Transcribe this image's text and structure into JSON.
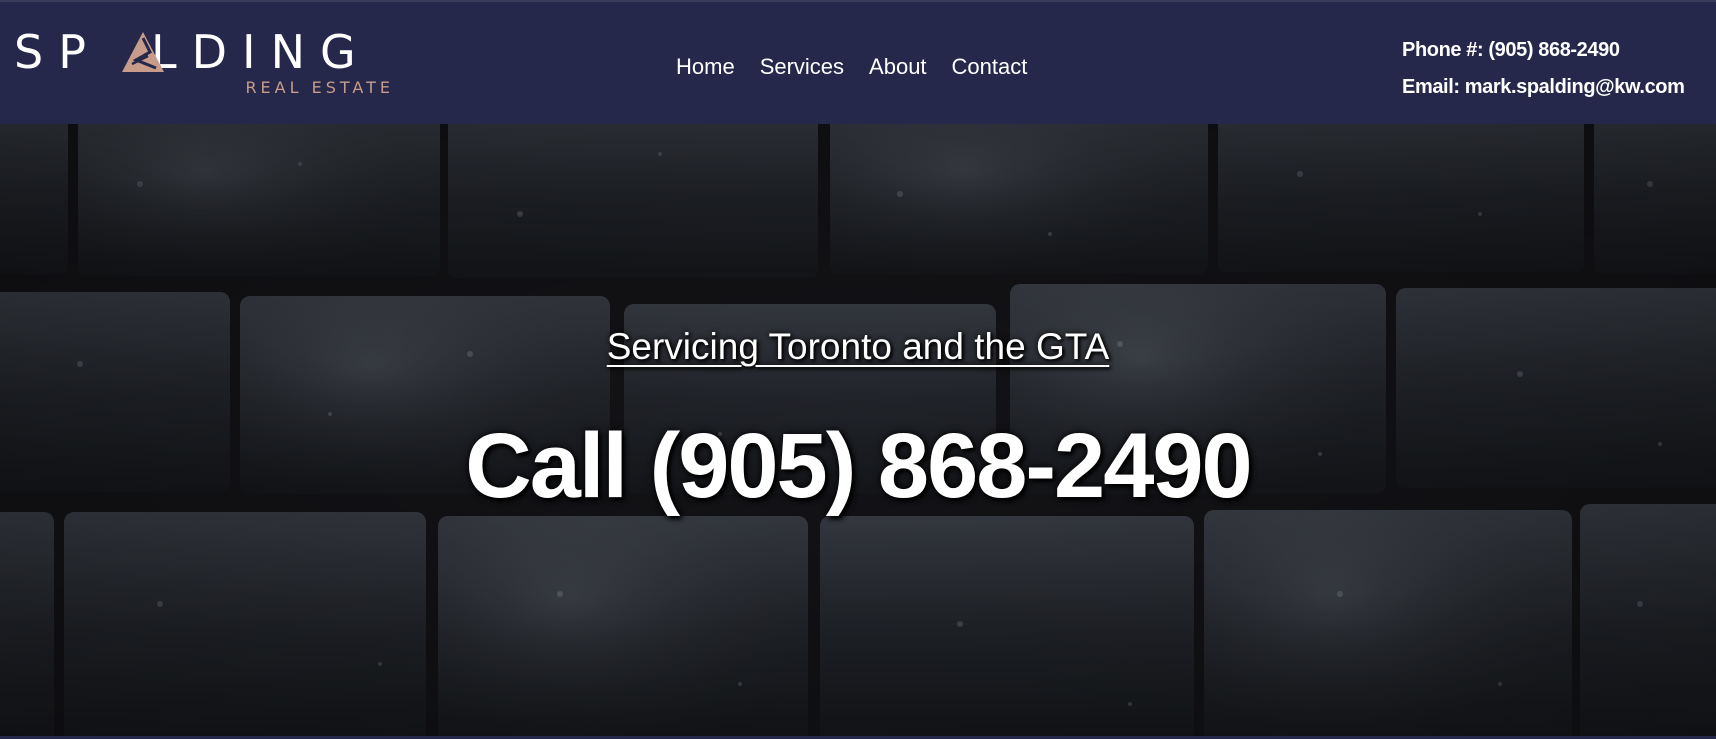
{
  "brand": {
    "word_left": "SP",
    "word_right": "LDING",
    "subtitle": "REAL ESTATE",
    "accent_color": "#c89c8a",
    "mark_icon": "triangle-a-logo-icon"
  },
  "nav": {
    "items": [
      {
        "label": "Home"
      },
      {
        "label": "Services"
      },
      {
        "label": "About"
      },
      {
        "label": "Contact"
      }
    ]
  },
  "contact": {
    "phone": "Phone #: (905) 868-2490",
    "email": "Email: mark.spalding@kw.com"
  },
  "hero": {
    "tagline": "Servicing Toronto and the GTA",
    "callout": "Call (905) 868-2490",
    "background": "dark-brick-wall"
  },
  "colors": {
    "header_bg": "#25284a",
    "text": "#ffffff"
  }
}
